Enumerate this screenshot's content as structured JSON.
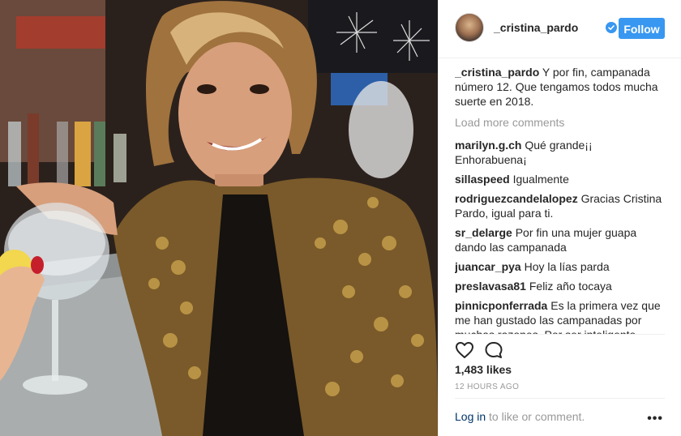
{
  "post": {
    "username": "_cristina_pardo",
    "verified": true,
    "follow_label": "Follow",
    "caption": {
      "username": "_cristina_pardo",
      "text": "Y por fin, campanada número 12. Que tengamos todos mucha suerte en 2018."
    },
    "load_more": "Load more comments",
    "comments": [
      {
        "user": "marilyn.g.ch",
        "text": "Qué grande¡¡ Enhorabuena¡"
      },
      {
        "user": "sillaspeed",
        "text": "Igualmente"
      },
      {
        "user": "rodriguezcandelalopez",
        "text": "Gracias Cristina Pardo, igual para ti."
      },
      {
        "user": "sr_delarge",
        "text": "Por fin una mujer guapa dando las campanada"
      },
      {
        "user": "juancar_pya",
        "text": "Hoy la lías parda"
      },
      {
        "user": "preslavasa81",
        "text": "Feliz año tocaya"
      },
      {
        "user": "pinnicponferrada",
        "text": "Es la primera vez que me han gustado las campanadas por muchas razones. Por ser inteligente, divertida. Qué no has necesitado semi desnudarte y has estado muy original dando las campanadas. Me ha gusta como"
      }
    ],
    "likes": "1,483 likes",
    "time": "12 HOURS AGO",
    "login_link": "Log in",
    "login_suffix": " to like or comment.",
    "more_label": "•••"
  },
  "icons": {
    "like": "heart-outline-icon",
    "comment": "speech-bubble-icon",
    "verified": "verified-badge-icon"
  },
  "colors": {
    "follow_button": "#3897f0",
    "link": "#003569",
    "muted": "#999999",
    "verified": "#3897f0"
  }
}
